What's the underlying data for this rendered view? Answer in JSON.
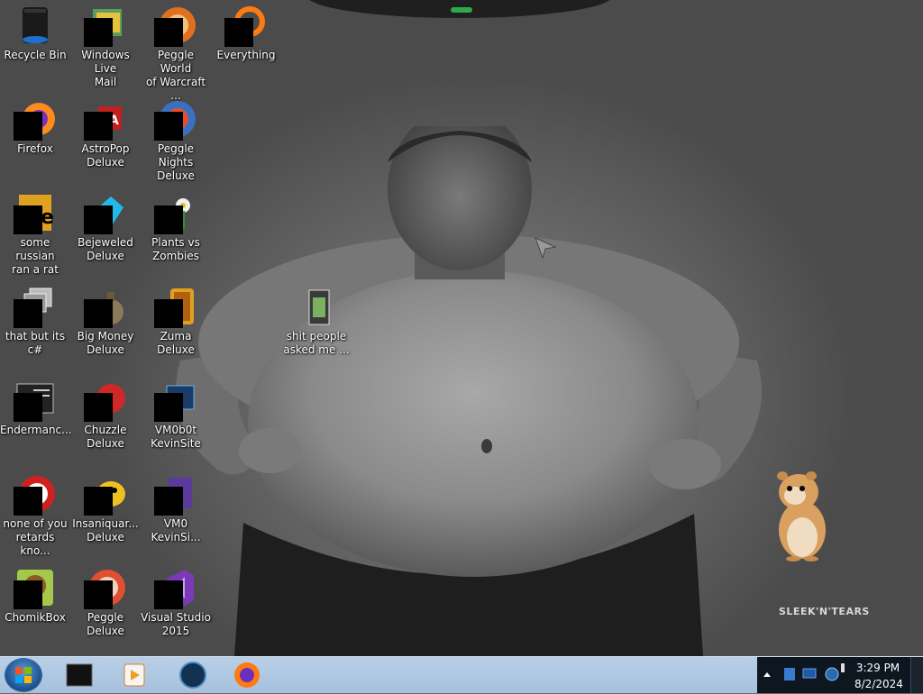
{
  "desktop": {
    "watermark": "SLEEK'N'TEARS",
    "icons": [
      {
        "label": "Recycle Bin"
      },
      {
        "label": "Windows Live\nMail"
      },
      {
        "label": "Peggle World\nof Warcraft ..."
      },
      {
        "label": "Everything"
      },
      {
        "label": "Firefox"
      },
      {
        "label": "AstroPop\nDeluxe"
      },
      {
        "label": "Peggle Nights\nDeluxe"
      },
      {
        "label": "some russian\nran a rat"
      },
      {
        "label": "Bejeweled\nDeluxe"
      },
      {
        "label": "Plants vs\nZombies"
      },
      {
        "label": "that but its c#"
      },
      {
        "label": "Big Money\nDeluxe"
      },
      {
        "label": "Zuma Deluxe"
      },
      {
        "label": "shit people\nasked me ..."
      },
      {
        "label": "Endermanc..."
      },
      {
        "label": "Chuzzle\nDeluxe"
      },
      {
        "label": "VM0b0t\nKevinSite"
      },
      {
        "label": "none of you\nretards kno..."
      },
      {
        "label": "Insaniquar...\nDeluxe"
      },
      {
        "label": "VM0\nKevinSi..."
      },
      {
        "label": "ChomikBox"
      },
      {
        "label": "Peggle Deluxe"
      },
      {
        "label": "Visual Studio\n2015"
      }
    ]
  },
  "taskbar": {
    "clock": {
      "time": "3:29 PM",
      "date": "8/2/2024"
    },
    "pinned": [
      "terminal-icon",
      "media-player-icon",
      "globe-icon",
      "firefox-icon"
    ]
  },
  "colors": {
    "taskbar": "#a9c3df",
    "tray": "#0e1620"
  }
}
